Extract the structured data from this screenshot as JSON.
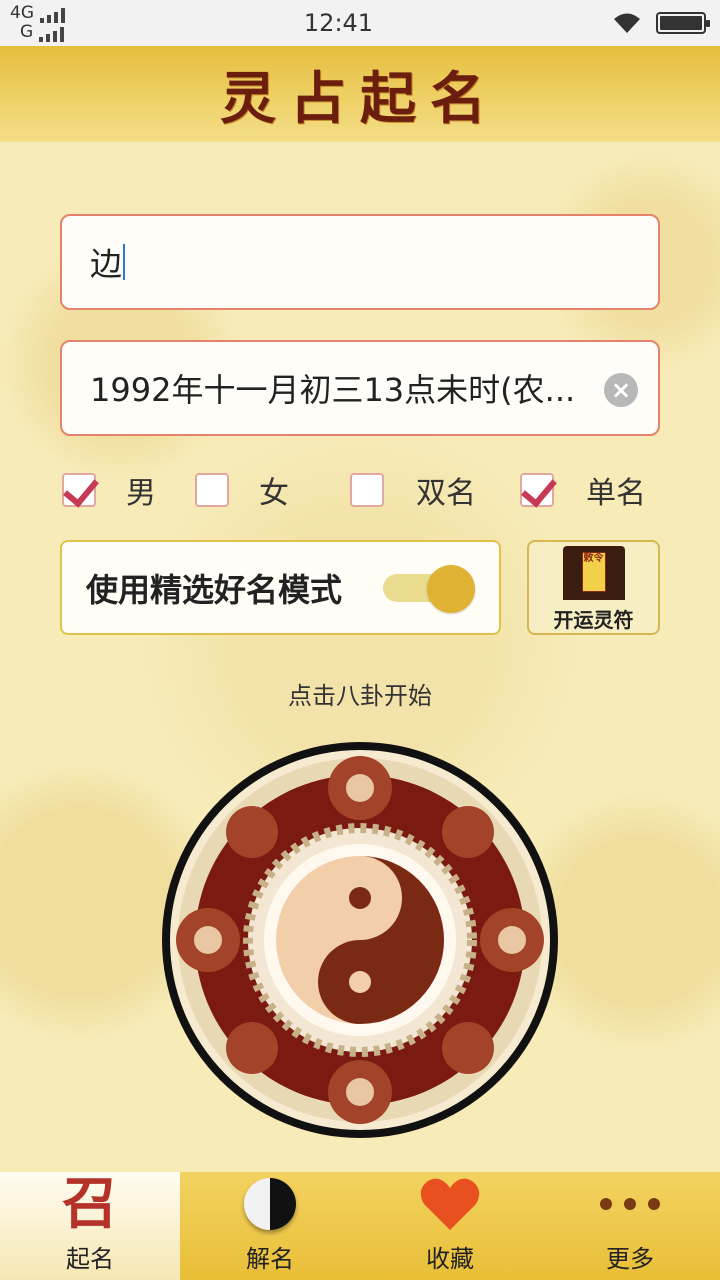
{
  "status_bar": {
    "network_top": "4G",
    "network_bottom": "G",
    "time": "12:41"
  },
  "header": {
    "title": "灵占起名"
  },
  "form": {
    "surname_value": "边",
    "birth_value": "1992年十一月初三13点未时(农...",
    "clear_glyph": "×",
    "options": [
      {
        "label": "男",
        "checked": true
      },
      {
        "label": "女",
        "checked": false
      },
      {
        "label": "双名",
        "checked": false
      },
      {
        "label": "单名",
        "checked": true
      }
    ],
    "mode_label": "使用精选好名模式",
    "mode_enabled": true,
    "charm_label": "开运灵符",
    "charm_paper_text": "敕令"
  },
  "hint": "点击八卦开始",
  "tabs": [
    {
      "label": "起名",
      "icon": "qiming-seal-icon",
      "active": true
    },
    {
      "label": "解名",
      "icon": "yin-yang-icon",
      "active": false
    },
    {
      "label": "收藏",
      "icon": "heart-icon",
      "active": false
    },
    {
      "label": "更多",
      "icon": "more-dots-icon",
      "active": false
    }
  ],
  "colors": {
    "header_gold": "#e6be3e",
    "accent_red": "#c63a55",
    "toggle_thumb": "#e0b233",
    "heart": "#e8511f"
  }
}
